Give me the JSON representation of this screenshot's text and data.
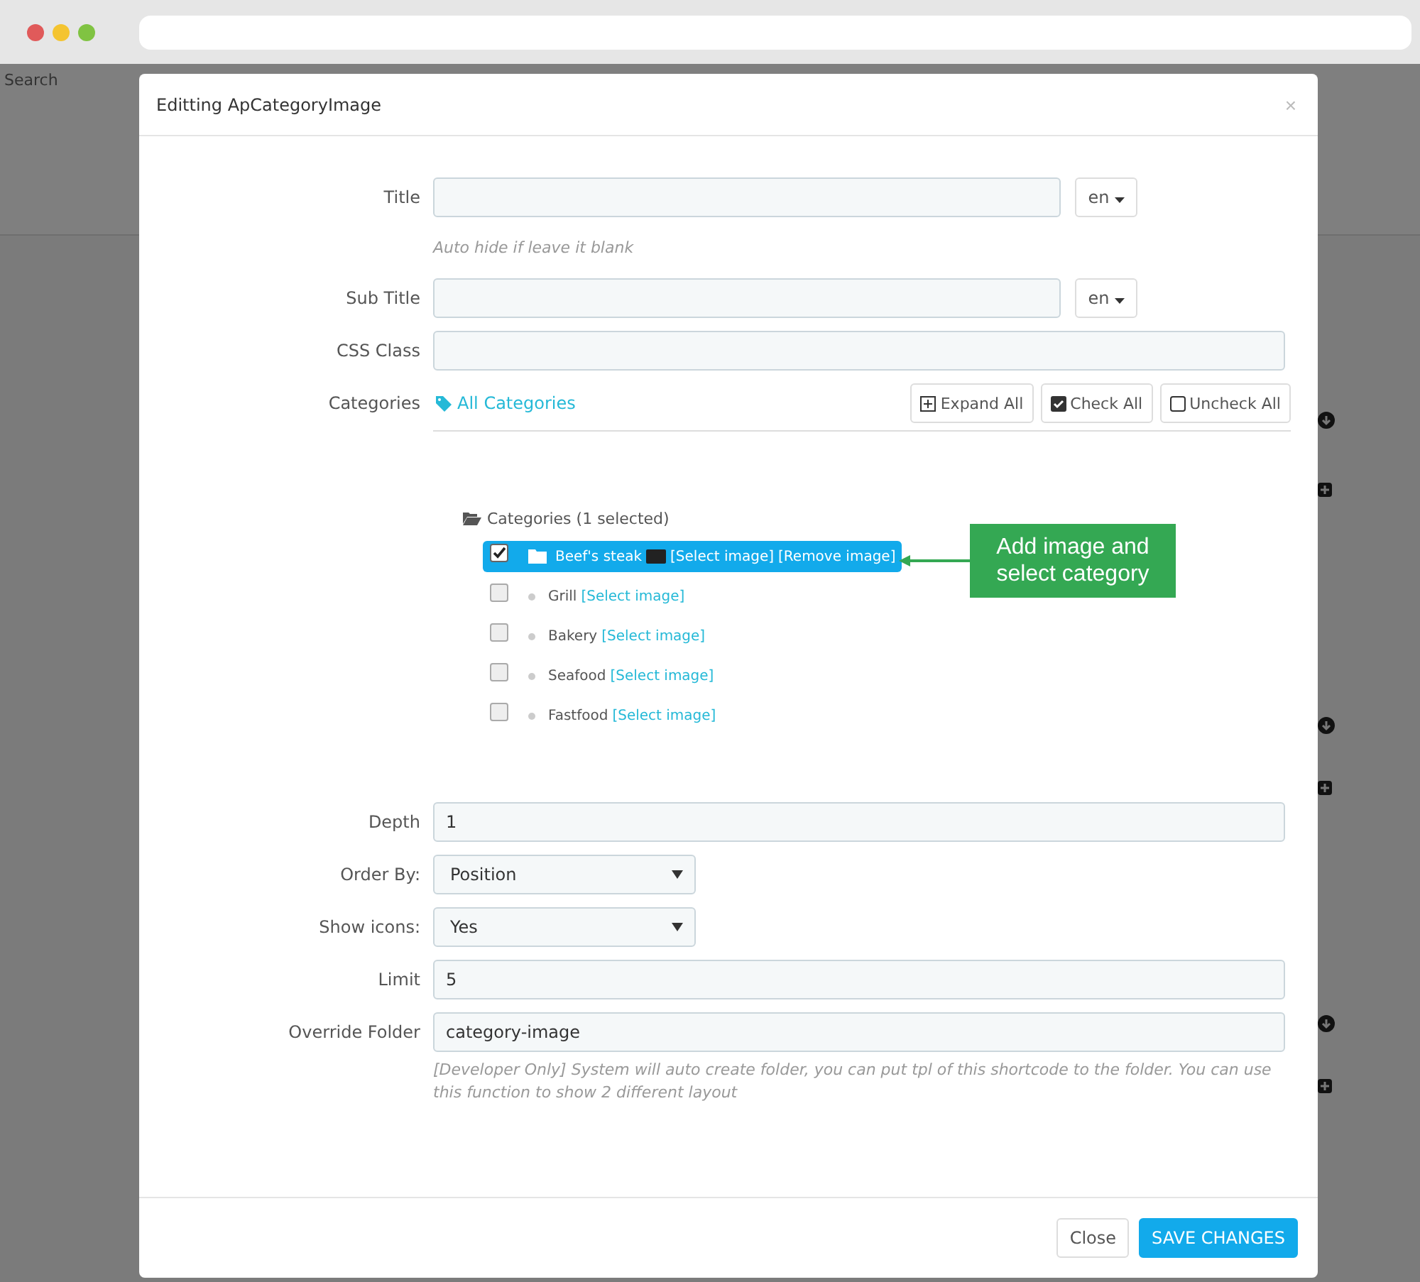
{
  "background": {
    "search_label": "Search"
  },
  "modal": {
    "title": "Editting ApCategoryImage",
    "close": "×"
  },
  "fields": [
    {
      "kind": "text-lang",
      "label": "Title",
      "lang": "en",
      "help": "Auto hide if leave it blank"
    },
    {
      "kind": "text-lang",
      "label": "Sub Title",
      "lang": "en"
    },
    {
      "kind": "text",
      "label": "CSS Class"
    },
    {
      "kind": "categories",
      "label": "Categories",
      "link": "All Categories",
      "buttons": [
        {
          "label": "Expand All"
        },
        {
          "label": "Check All"
        },
        {
          "label": "Uncheck All"
        }
      ],
      "tree": {
        "label": "Categories (1 selected)",
        "children": [
          {
            "name": "Beef's steak",
            "checked": true,
            "kind": "folder",
            "has_image": true,
            "links": [
              "[Select image]",
              "[Remove image]"
            ]
          },
          {
            "name": "Grill",
            "checked": false,
            "kind": "leaf",
            "has_image": false,
            "links": [
              "[Select image]"
            ]
          },
          {
            "name": "Bakery",
            "checked": false,
            "kind": "leaf",
            "has_image": false,
            "links": [
              "[Select image]"
            ]
          },
          {
            "name": "Seafood",
            "checked": false,
            "kind": "leaf",
            "has_image": false,
            "links": [
              "[Select image]"
            ]
          },
          {
            "name": "Fastfood",
            "checked": false,
            "kind": "leaf",
            "has_image": false,
            "links": [
              "[Select image]"
            ]
          }
        ]
      }
    },
    {
      "kind": "text",
      "label": "Depth",
      "value": "1"
    },
    {
      "kind": "select",
      "label": "Order By:",
      "value": "Position"
    },
    {
      "kind": "select",
      "label": "Show icons:",
      "value": "Yes"
    },
    {
      "kind": "text",
      "label": "Limit",
      "value": "5"
    },
    {
      "kind": "text",
      "label": "Override Folder",
      "value": "category-image",
      "help": "[Developer Only] System will auto create folder, you can put tpl of this shortcode to the folder. You can use this function to show 2 different layout"
    }
  ],
  "footer": {
    "buttons": [
      {
        "label": "Close",
        "primary": false
      },
      {
        "label": "SAVE CHANGES",
        "primary": true
      }
    ]
  },
  "callout": {
    "text": "Add image and select category"
  }
}
